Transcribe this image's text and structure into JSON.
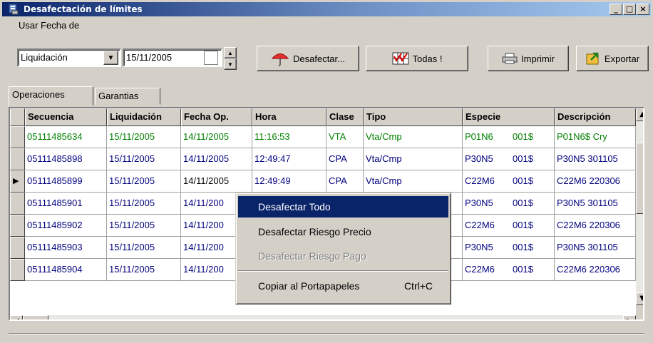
{
  "window": {
    "title": "Desafectación de límites",
    "controls": [
      "_",
      "□",
      "×"
    ],
    "control_icons": [
      "minimize-icon",
      "maximize-icon",
      "close-icon"
    ]
  },
  "toolbar": {
    "date_group_label": "Usar Fecha de",
    "date_type_value": "Liquidación",
    "date_value": "15/11/2005",
    "desafectar_label": "Desafectar...",
    "todas_label": "Todas !",
    "imprimir_label": "Imprimir",
    "exportar_label": "Exportar"
  },
  "tabs": [
    {
      "label": "Operaciones",
      "active": true
    },
    {
      "label": "Garantias",
      "active": false
    }
  ],
  "grid": {
    "columns": [
      "Secuencia",
      "Liquidación",
      "Fecha Op.",
      "Hora",
      "Clase",
      "Tipo",
      "Especie",
      "Descripción"
    ],
    "rows": [
      {
        "secuencia": "05111485634",
        "liquidacion": "15/11/2005",
        "fecha_op": "14/11/2005",
        "hora": "11:16:53",
        "clase": "VTA",
        "tipo": "Vta/Cmp",
        "especie": "P01N6",
        "especie_code": "001$",
        "descripcion": "P01N6$ Cry",
        "color": "green",
        "current": false
      },
      {
        "secuencia": "05111485898",
        "liquidacion": "15/11/2005",
        "fecha_op": "14/11/2005",
        "hora": "12:49:47",
        "clase": "CPA",
        "tipo": "Vta/Cmp",
        "especie": "P30N5",
        "especie_code": "001$",
        "descripcion": "P30N5 301105",
        "color": "blue",
        "current": false
      },
      {
        "secuencia": "05111485899",
        "liquidacion": "15/11/2005",
        "fecha_op": "14/11/2005",
        "hora": "12:49:49",
        "clase": "CPA",
        "tipo": "Vta/Cmp",
        "especie": "C22M6",
        "especie_code": "001$",
        "descripcion": "C22M6 220306",
        "color": "blue",
        "current": true
      },
      {
        "secuencia": "05111485901",
        "liquidacion": "15/11/2005",
        "fecha_op": "14/11/200",
        "hora": "",
        "clase": "",
        "tipo": "",
        "especie": "P30N5",
        "especie_code": "001$",
        "descripcion": "P30N5 301105",
        "color": "blue",
        "current": false
      },
      {
        "secuencia": "05111485902",
        "liquidacion": "15/11/2005",
        "fecha_op": "14/11/200",
        "hora": "",
        "clase": "",
        "tipo": "",
        "especie": "C22M6",
        "especie_code": "001$",
        "descripcion": "C22M6 220306",
        "color": "blue",
        "current": false
      },
      {
        "secuencia": "05111485903",
        "liquidacion": "15/11/2005",
        "fecha_op": "14/11/200",
        "hora": "",
        "clase": "",
        "tipo": "",
        "especie": "P30N5",
        "especie_code": "001$",
        "descripcion": "P30N5 301105",
        "color": "blue",
        "current": false
      },
      {
        "secuencia": "05111485904",
        "liquidacion": "15/11/2005",
        "fecha_op": "14/11/200",
        "hora": "",
        "clase": "",
        "tipo": "",
        "especie": "C22M6",
        "especie_code": "001$",
        "descripcion": "C22M6 220306",
        "color": "blue",
        "current": false
      }
    ]
  },
  "context_menu": {
    "items": [
      {
        "label": "Desafectar Todo",
        "shortcut": "",
        "state": "selected"
      },
      {
        "label": "Desafectar Riesgo Precio",
        "shortcut": "",
        "state": "enabled"
      },
      {
        "label": "Desafectar Riesgo Pago",
        "shortcut": "",
        "state": "disabled"
      },
      {
        "label": "Copiar al Portapapeles",
        "shortcut": "Ctrl+C",
        "state": "enabled"
      }
    ]
  },
  "colors": {
    "title_gradient_start": "#0a246a",
    "title_gradient_end": "#a6caf0",
    "row_green": "#008000",
    "row_blue": "#00007f",
    "menu_selection": "#0a246a"
  }
}
